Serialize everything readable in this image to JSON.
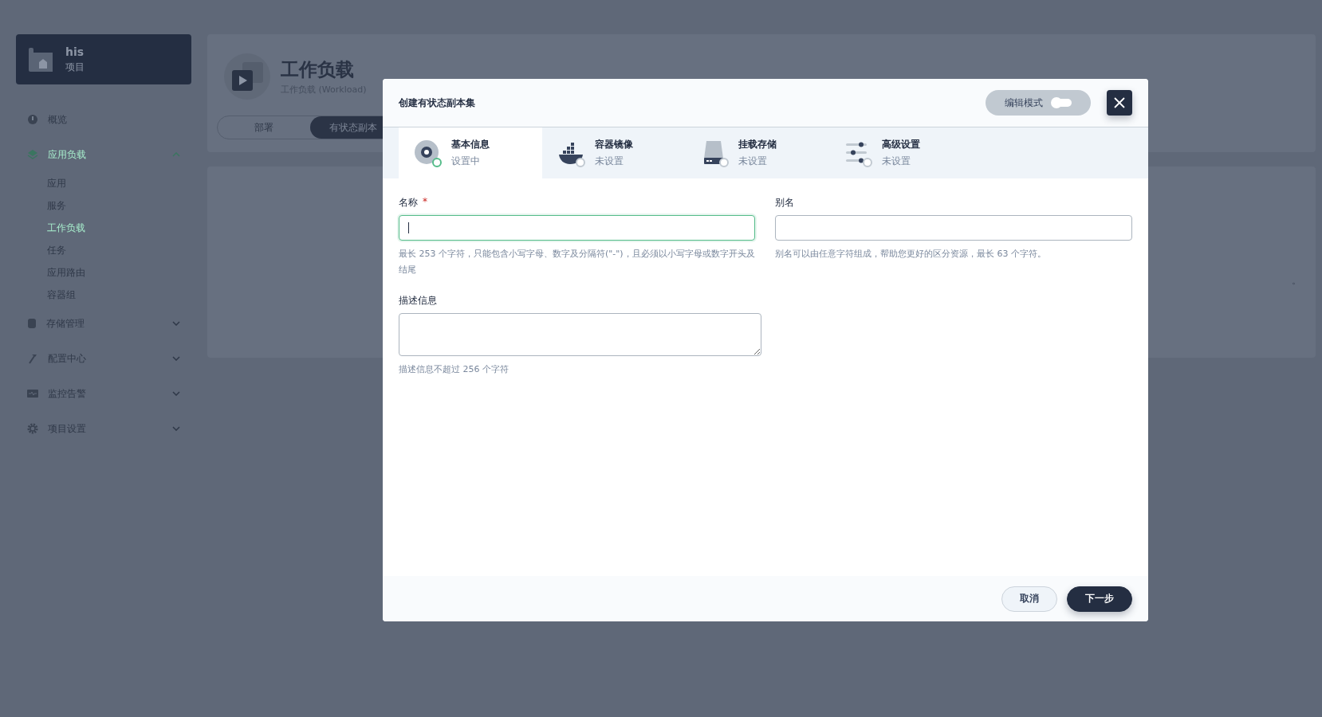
{
  "project": {
    "name": "his",
    "type": "项目"
  },
  "sidebar": {
    "items": [
      {
        "kind": "link",
        "label": "概览",
        "selected": false
      },
      {
        "kind": "group",
        "label": "应用负载",
        "selected": true,
        "expanded": true,
        "children": [
          {
            "label": "应用",
            "selected": false
          },
          {
            "label": "服务",
            "selected": false
          },
          {
            "label": "工作负载",
            "selected": true
          },
          {
            "label": "任务",
            "selected": false
          },
          {
            "label": "应用路由",
            "selected": false
          },
          {
            "label": "容器组",
            "selected": false
          }
        ]
      },
      {
        "kind": "group",
        "label": "存储管理",
        "selected": false,
        "expanded": false
      },
      {
        "kind": "group",
        "label": "配置中心",
        "selected": false,
        "expanded": false
      },
      {
        "kind": "group",
        "label": "监控告警",
        "selected": false,
        "expanded": false
      },
      {
        "kind": "group",
        "label": "项目设置",
        "selected": false,
        "expanded": false
      }
    ]
  },
  "page_header": {
    "title": "工作负载",
    "subtitle": "工作负载 (Workload)"
  },
  "page_tabs": [
    {
      "label": "部署",
      "selected": false
    },
    {
      "label": "有状态副本",
      "selected": true
    }
  ],
  "background_fragment": "。",
  "dialog": {
    "title": "创建有状态副本集",
    "edit_mode": {
      "label": "编辑模式",
      "on": false
    },
    "steps": [
      {
        "title": "基本信息",
        "status": "设置中",
        "selected": true
      },
      {
        "title": "容器镜像",
        "status": "未设置",
        "selected": false
      },
      {
        "title": "挂载存储",
        "status": "未设置",
        "selected": false
      },
      {
        "title": "高级设置",
        "status": "未设置",
        "selected": false
      }
    ],
    "fields": [
      {
        "kind": "input",
        "label": "名称",
        "required_mark": "*",
        "focused": true,
        "hint": "最长 253 个字符，只能包含小写字母、数字及分隔符(\"-\")，且必须以小写字母或数字开头及结尾"
      },
      {
        "kind": "input",
        "label": "别名",
        "focused": false,
        "hint": "别名可以由任意字符组成，帮助您更好的区分资源，最长 63 个字符。"
      },
      {
        "kind": "textarea",
        "label": "描述信息",
        "focused": false,
        "hint": "描述信息不超过 256 个字符"
      }
    ],
    "buttons": [
      {
        "kind": "secondary",
        "label": "取消"
      },
      {
        "kind": "primary",
        "label": "下一步"
      }
    ]
  }
}
